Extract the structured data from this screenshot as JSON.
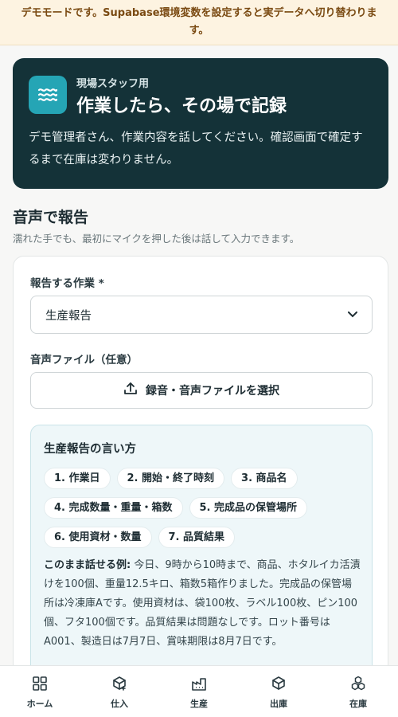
{
  "banner": {
    "text": "デモモードです。Supabase環境変数を設定すると実データへ切り替わります。"
  },
  "hero": {
    "icon": "waves-icon",
    "eyebrow": "現場スタッフ用",
    "title": "作業したら、その場で記録",
    "description": "デモ管理者さん、作業内容を話してください。確認画面で確定するまで在庫は変わりません。"
  },
  "section": {
    "title": "音声で報告",
    "subtitle": "濡れた手でも、最初にマイクを押した後は話して入力できます。"
  },
  "form": {
    "task_label": "報告する作業 *",
    "task_value": "生産報告",
    "file_label": "音声ファイル（任意）",
    "upload_label": "録音・音声ファイルを選択"
  },
  "guide": {
    "title": "生産報告の言い方",
    "chips_row1": [
      "1. 作業日",
      "2. 開始・終了時刻",
      "3. 商品名"
    ],
    "chips_row2": [
      "4. 完成数量・重量・箱数",
      "5. 完成品の保管場所"
    ],
    "chips_row3": [
      "6. 使用資材・数量",
      "7. 品質結果"
    ],
    "example_label": "このまま話せる例:",
    "example_text": " 今日、9時から10時まで、商品、ホタルイカ活漬けを100個、重量12.5キロ、箱数5箱作りました。完成品の保管場所は冷凍庫Aです。使用資材は、袋100枚、ラベル100枚、ピン100個、フタ100個です。品質結果は問題なしです。ロット番号はA001、製造日は7月7日、賞味期限は8月7日です。"
  },
  "tabs": [
    {
      "label": "ホーム",
      "icon": "grid-icon"
    },
    {
      "label": "仕入",
      "icon": "box-plus-icon"
    },
    {
      "label": "生産",
      "icon": "factory-icon"
    },
    {
      "label": "出庫",
      "icon": "box-out-icon"
    },
    {
      "label": "在庫",
      "icon": "boxes-icon"
    }
  ]
}
